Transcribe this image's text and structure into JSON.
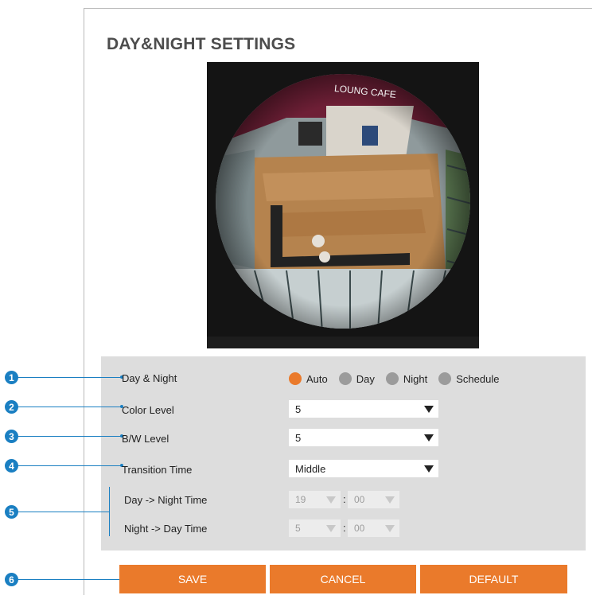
{
  "page": {
    "title": "DAY&NIGHT SETTINGS"
  },
  "video": {
    "overlay_text": "LOUNG CAFE"
  },
  "callouts": [
    "1",
    "2",
    "3",
    "4",
    "5",
    "6"
  ],
  "day_night": {
    "label": "Day & Night",
    "options": [
      "Auto",
      "Day",
      "Night",
      "Schedule"
    ],
    "selected": "Auto"
  },
  "color_level": {
    "label": "Color Level",
    "value": "5"
  },
  "bw_level": {
    "label": "B/W Level",
    "value": "5"
  },
  "transition_time": {
    "label": "Transition Time",
    "value": "Middle"
  },
  "schedule": {
    "day_to_night": {
      "label": "Day -> Night Time",
      "hour": "19",
      "minute": "00"
    },
    "night_to_day": {
      "label": "Night -> Day Time",
      "hour": "5",
      "minute": "00"
    },
    "separator": ":"
  },
  "buttons": {
    "save": "SAVE",
    "cancel": "CANCEL",
    "default": "DEFAULT"
  },
  "colors": {
    "accent": "#ea7a2b",
    "callout": "#1a7fc2",
    "panel": "#dddddd"
  }
}
